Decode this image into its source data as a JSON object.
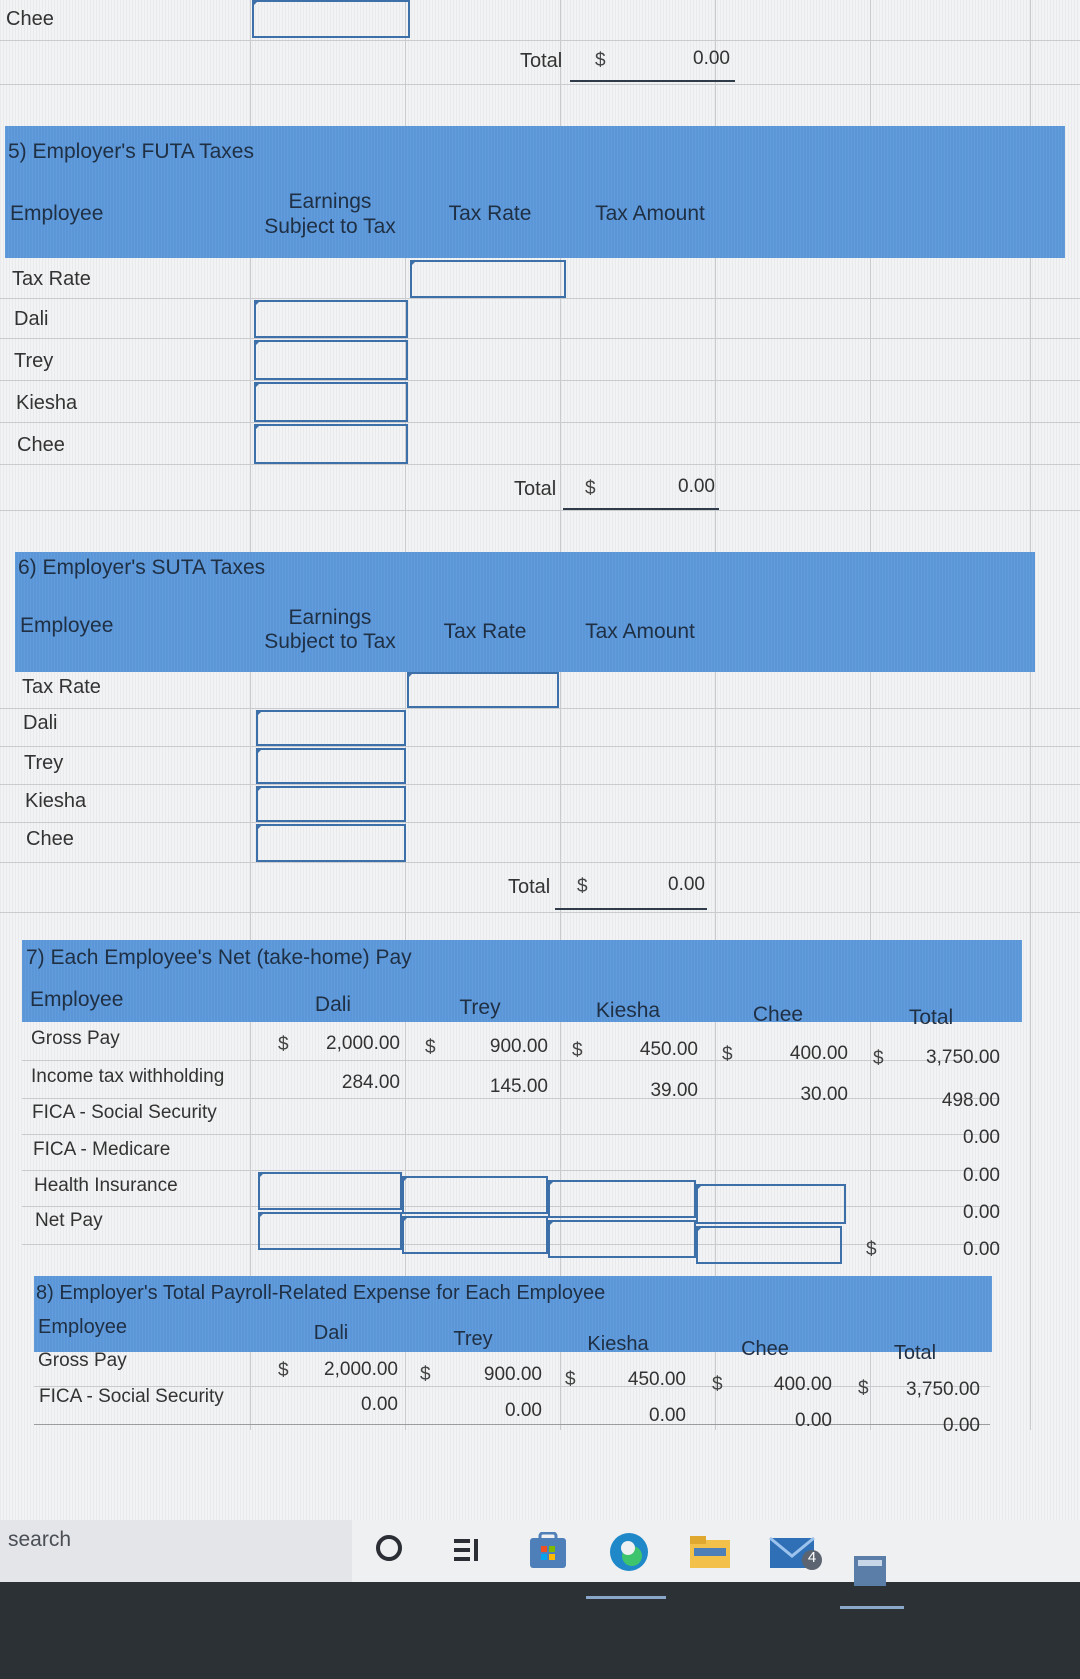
{
  "top_section": {
    "employee_last": "Chee",
    "total_label": "Total",
    "total_dollar": "$",
    "total_value": "0.00"
  },
  "futa": {
    "title": "5) Employer's FUTA Taxes",
    "col_employee": "Employee",
    "col_earnings_line1": "Earnings",
    "col_earnings_line2": "Subject to Tax",
    "col_rate": "Tax Rate",
    "col_amount": "Tax Amount",
    "rows": [
      "Tax Rate",
      "Dali",
      "Trey",
      "Kiesha",
      "Chee"
    ],
    "total_label": "Total",
    "total_dollar": "$",
    "total_value": "0.00"
  },
  "suta": {
    "title": "6) Employer's SUTA Taxes",
    "col_employee": "Employee",
    "col_earnings_line1": "Earnings",
    "col_earnings_line2": "Subject to Tax",
    "col_rate": "Tax Rate",
    "col_amount": "Tax Amount",
    "rows": [
      "Tax Rate",
      "Dali",
      "Trey",
      "Kiesha",
      "Chee"
    ],
    "total_label": "Total",
    "total_dollar": "$",
    "total_value": "0.00"
  },
  "netpay": {
    "title": "7) Each Employee's Net (take-home) Pay",
    "col_employee": "Employee",
    "cols": [
      "Dali",
      "Trey",
      "Kiesha",
      "Chee",
      "Total"
    ],
    "dollar": "$",
    "rows": [
      {
        "label": "Gross Pay",
        "values": [
          "2,000.00",
          "900.00",
          "450.00",
          "400.00",
          "3,750.00"
        ]
      },
      {
        "label": "Income tax withholding",
        "values": [
          "284.00",
          "145.00",
          "39.00",
          "30.00",
          "498.00"
        ]
      },
      {
        "label": "FICA - Social Security",
        "values": [
          "",
          "",
          "",
          "",
          "0.00"
        ]
      },
      {
        "label": "FICA - Medicare",
        "values": [
          "",
          "",
          "",
          "",
          "0.00"
        ]
      },
      {
        "label": "Health Insurance",
        "values": [
          "",
          "",
          "",
          "",
          "0.00"
        ]
      },
      {
        "label": "Net Pay",
        "values": [
          "",
          "",
          "",
          "",
          "0.00"
        ]
      }
    ]
  },
  "expense": {
    "title": "8) Employer's Total Payroll-Related Expense for Each Employee",
    "col_employee": "Employee",
    "cols": [
      "Dali",
      "Trey",
      "Kiesha",
      "Chee",
      "Total"
    ],
    "dollar": "$",
    "rows": [
      {
        "label": "Gross Pay",
        "values": [
          "2,000.00",
          "900.00",
          "450.00",
          "400.00",
          "3,750.00"
        ]
      },
      {
        "label": "FICA - Social Security",
        "values": [
          "0.00",
          "0.00",
          "0.00",
          "0.00",
          "0.00"
        ]
      }
    ]
  },
  "taskbar": {
    "search_text": "search",
    "mail_badge": "4",
    "icons": [
      "cortana-circle-icon",
      "task-view-icon",
      "store-icon",
      "edge-icon",
      "file-explorer-icon",
      "mail-icon",
      "calculator-icon"
    ]
  }
}
